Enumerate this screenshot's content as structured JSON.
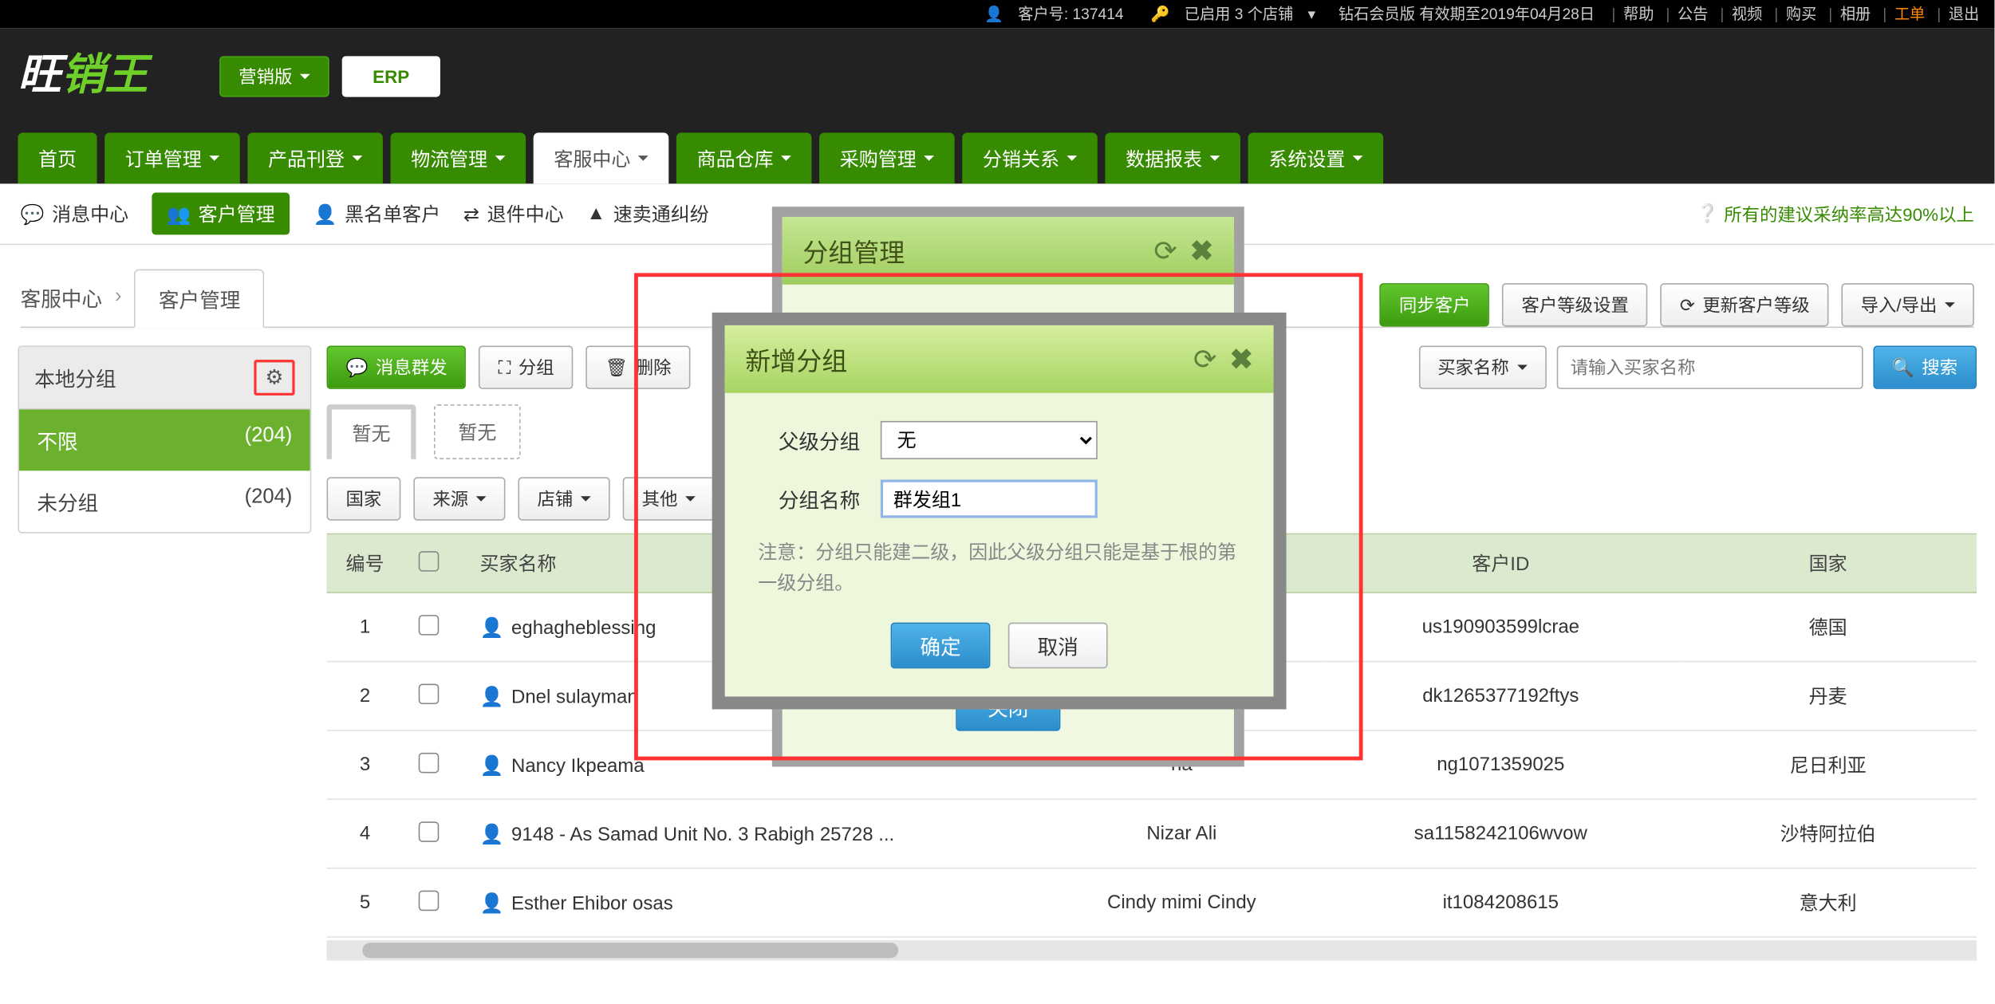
{
  "topbar": {
    "customer_label": "客户号: 137414",
    "key_label": "已启用 3 个店铺",
    "member_label": "钻石会员版 有效期至2019年04月28日",
    "links": [
      "帮助",
      "公告",
      "视频",
      "购买",
      "相册",
      "工单",
      "退出"
    ]
  },
  "header": {
    "edition_btn": "营销版",
    "erp_btn": "ERP",
    "nav": [
      "首页",
      "订单管理",
      "产品刊登",
      "物流管理",
      "客服中心",
      "商品仓库",
      "采购管理",
      "分销关系",
      "数据报表",
      "系统设置"
    ],
    "nav_active_index": 4
  },
  "subbar": {
    "items": [
      {
        "icon": "comment",
        "label": "消息中心"
      },
      {
        "icon": "users",
        "label": "客户管理",
        "active": true
      },
      {
        "icon": "blacklist",
        "label": "黑名单客户"
      },
      {
        "icon": "return",
        "label": "退件中心"
      },
      {
        "icon": "warn",
        "label": "速卖通纠纷"
      }
    ],
    "right_info": "所有的建议采纳率高达90%以上"
  },
  "breadcrumb": {
    "root": "客服中心",
    "tab": "客户管理"
  },
  "actions": {
    "sync": "同步客户",
    "level_setting": "客户等级设置",
    "update_level": "更新客户等级",
    "import_export": "导入/导出"
  },
  "sidebar": {
    "title": "本地分组",
    "items": [
      {
        "label": "不限",
        "count": "(204)",
        "active": true
      },
      {
        "label": "未分组",
        "count": "(204)",
        "active": false
      }
    ]
  },
  "toolbar": {
    "mass_msg": "消息群发",
    "group_btn": "分组",
    "delete_btn": "删除"
  },
  "tabs": {
    "tab_a": "暂无",
    "tab_b": "暂无"
  },
  "filters": {
    "items": [
      "国家",
      "来源",
      "店铺",
      "其他"
    ]
  },
  "search": {
    "dropdown_label": "买家名称",
    "placeholder": "请输入买家名称",
    "button": "搜索"
  },
  "table": {
    "columns": [
      "编号",
      "",
      "买家名称",
      "",
      "客户ID",
      "国家"
    ],
    "rows": [
      {
        "idx": "1",
        "name": "eghagheblessing",
        "mid": "",
        "cid": "us190903599lcrae",
        "country": "德国"
      },
      {
        "idx": "2",
        "name": "Dnel sulayman",
        "mid": "",
        "cid": "dk1265377192ftys",
        "country": "丹麦"
      },
      {
        "idx": "3",
        "name": "Nancy Ikpeama",
        "mid": "na",
        "cid": "ng1071359025",
        "country": "尼日利亚"
      },
      {
        "idx": "4",
        "name": "9148 - As Samad Unit No. 3 Rabigh 25728 ...",
        "mid": "Nizar Ali",
        "cid": "sa1158242106wvow",
        "country": "沙特阿拉伯"
      },
      {
        "idx": "5",
        "name": "Esther Ehibor osas",
        "mid": "Cindy mimi Cindy",
        "cid": "it1084208615",
        "country": "意大利"
      }
    ]
  },
  "outer_modal": {
    "title": "分组管理",
    "close_btn": "关闭"
  },
  "inner_modal": {
    "title": "新增分组",
    "parent_label": "父级分组",
    "parent_value": "无",
    "name_label": "分组名称",
    "name_value": "群发组1",
    "note": "注意：分组只能建二级，因此父级分组只能是基于根的第一级分组。",
    "ok": "确定",
    "cancel": "取消"
  }
}
